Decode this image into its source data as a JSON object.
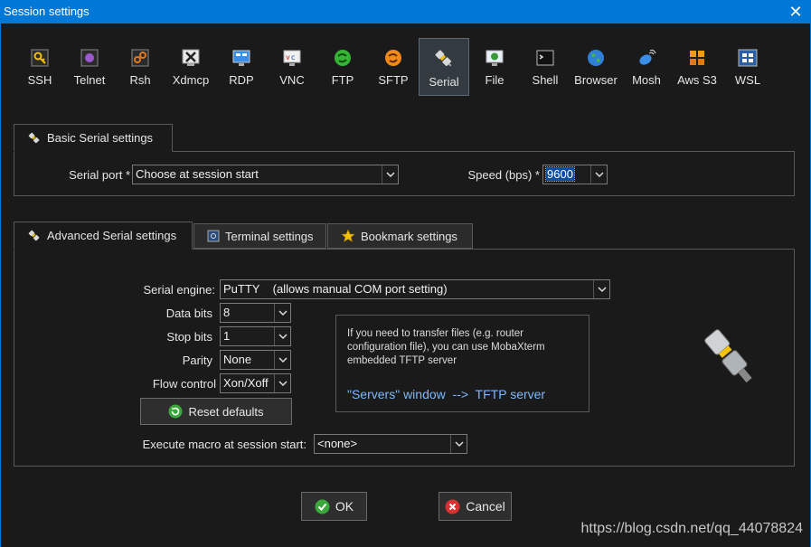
{
  "window": {
    "title": "Session settings",
    "close_glyph": "✕"
  },
  "session_types": [
    {
      "label": "SSH",
      "icon": "ssh-icon"
    },
    {
      "label": "Telnet",
      "icon": "telnet-icon"
    },
    {
      "label": "Rsh",
      "icon": "rsh-icon"
    },
    {
      "label": "Xdmcp",
      "icon": "xdmcp-icon"
    },
    {
      "label": "RDP",
      "icon": "rdp-icon"
    },
    {
      "label": "VNC",
      "icon": "vnc-icon"
    },
    {
      "label": "FTP",
      "icon": "ftp-icon"
    },
    {
      "label": "SFTP",
      "icon": "sftp-icon"
    },
    {
      "label": "Serial",
      "icon": "serial-plug-icon",
      "selected": true
    },
    {
      "label": "File",
      "icon": "file-icon"
    },
    {
      "label": "Shell",
      "icon": "shell-icon"
    },
    {
      "label": "Browser",
      "icon": "browser-globe-icon"
    },
    {
      "label": "Mosh",
      "icon": "mosh-satellite-icon"
    },
    {
      "label": "Aws S3",
      "icon": "aws-s3-icon"
    },
    {
      "label": "WSL",
      "icon": "wsl-windows-icon"
    }
  ],
  "basic": {
    "tab_label": "Basic Serial settings",
    "serial_port_label": "Serial port *",
    "serial_port_value": "Choose at session start",
    "speed_label": "Speed (bps) *",
    "speed_value": "9600"
  },
  "advanced_tabs": [
    {
      "label": "Advanced Serial settings",
      "icon": "plug-icon",
      "active": true
    },
    {
      "label": "Terminal settings",
      "icon": "terminal-icon",
      "active": false
    },
    {
      "label": "Bookmark settings",
      "icon": "star-icon",
      "active": false
    }
  ],
  "advanced": {
    "serial_engine_label": "Serial engine:",
    "serial_engine_value": "PuTTY    (allows manual COM port setting)",
    "data_bits_label": "Data bits",
    "data_bits_value": "8",
    "stop_bits_label": "Stop bits",
    "stop_bits_value": "1",
    "parity_label": "Parity",
    "parity_value": "None",
    "flow_control_label": "Flow control",
    "flow_control_value": "Xon/Xoff",
    "reset_label": "Reset defaults",
    "macro_label": "Execute macro at session start:",
    "macro_value": "<none>",
    "info_text": "If you need to transfer files (e.g. router configuration file), you can use MobaXterm embedded TFTP server",
    "info_link": "\"Servers\" window  -->  TFTP server"
  },
  "buttons": {
    "ok": "OK",
    "cancel": "Cancel"
  },
  "watermark": "https://blog.csdn.net/qq_44078824",
  "colors": {
    "accent": "#0078d7",
    "background": "#1a1a1a",
    "link": "#7db8ff",
    "selection": "#0a4ea3"
  }
}
